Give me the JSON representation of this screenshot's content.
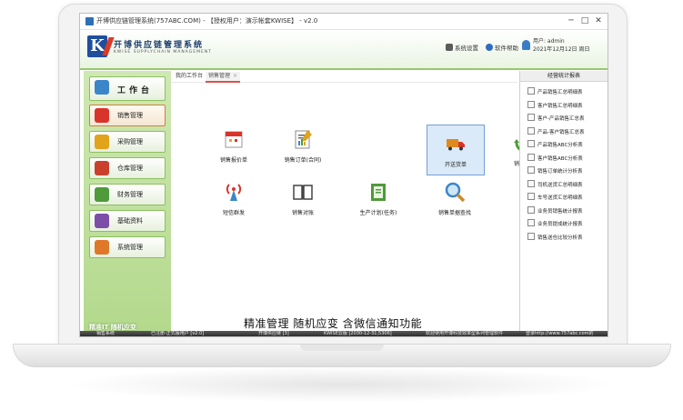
{
  "window": {
    "title": "开博供应链管理系统(757ABC.COM) - 【授权用户：演示帐套KWISE】 - v2.0",
    "min_glyph": "─",
    "max_glyph": "□",
    "close_glyph": "✕"
  },
  "header": {
    "brand_cn": "开博供应链管理系统",
    "brand_en": "KWISE SUPPLYCHAIN MANAGEMENT",
    "settings": "系统设置",
    "help": "软件帮助",
    "user_line1": "用户: admin",
    "user_line2": "2021年12月12日 周日"
  },
  "sidebar": {
    "items": [
      {
        "label": "工作台"
      },
      {
        "label": "销售管理"
      },
      {
        "label": "采购管理"
      },
      {
        "label": "仓库管理"
      },
      {
        "label": "财务管理"
      },
      {
        "label": "基础资料"
      },
      {
        "label": "系统管理"
      }
    ],
    "footer": "精准IT 随机应变"
  },
  "tabs": [
    {
      "label": "我的工作台"
    },
    {
      "label": "销售管理",
      "close": "×"
    }
  ],
  "tiles": [
    {
      "label": "销售报价单"
    },
    {
      "label": "销售订单(合同)"
    },
    {
      "label": "开送货单"
    },
    {
      "label": "销售退货"
    },
    {
      "label": "短信群发"
    },
    {
      "label": "销售对账"
    },
    {
      "label": "生产计划(任务)"
    },
    {
      "label": "销售单据查找"
    }
  ],
  "slogan": "精准管理 随机应变 含微信通知功能",
  "reports": {
    "title": "经营统计报表",
    "items": [
      "产品销售汇总明细表",
      "客户销售汇总明细表",
      "客户-产品销售汇总表",
      "产品-客户销售汇总表",
      "产品销售ABC分析表",
      "客户销售ABC分析表",
      "销售订单统计分析表",
      "司机送货汇总明细表",
      "车号送货汇总明细表",
      "业务员销售统计报表",
      "业务员提成统计报表",
      "销售送仓比较分析表"
    ]
  },
  "statusbar": {
    "s1": "销售系统",
    "s2": "已注册-正式版用户 [v2.0]",
    "s3": "开博供应链 [3]",
    "s4": "KWISE云版 [2030-12-31,5306]",
    "s5": "欢迎使用开博科技效率型系列管理软件",
    "s6": "登录http://www.757abc.com的"
  },
  "colors": {
    "sidebar_green": "#b3d98c",
    "banner_accent": "#97c96b",
    "logo_blue": "#1f4e9c",
    "logo_red": "#d93a2b",
    "selection_blue": "#dbeaf8"
  }
}
